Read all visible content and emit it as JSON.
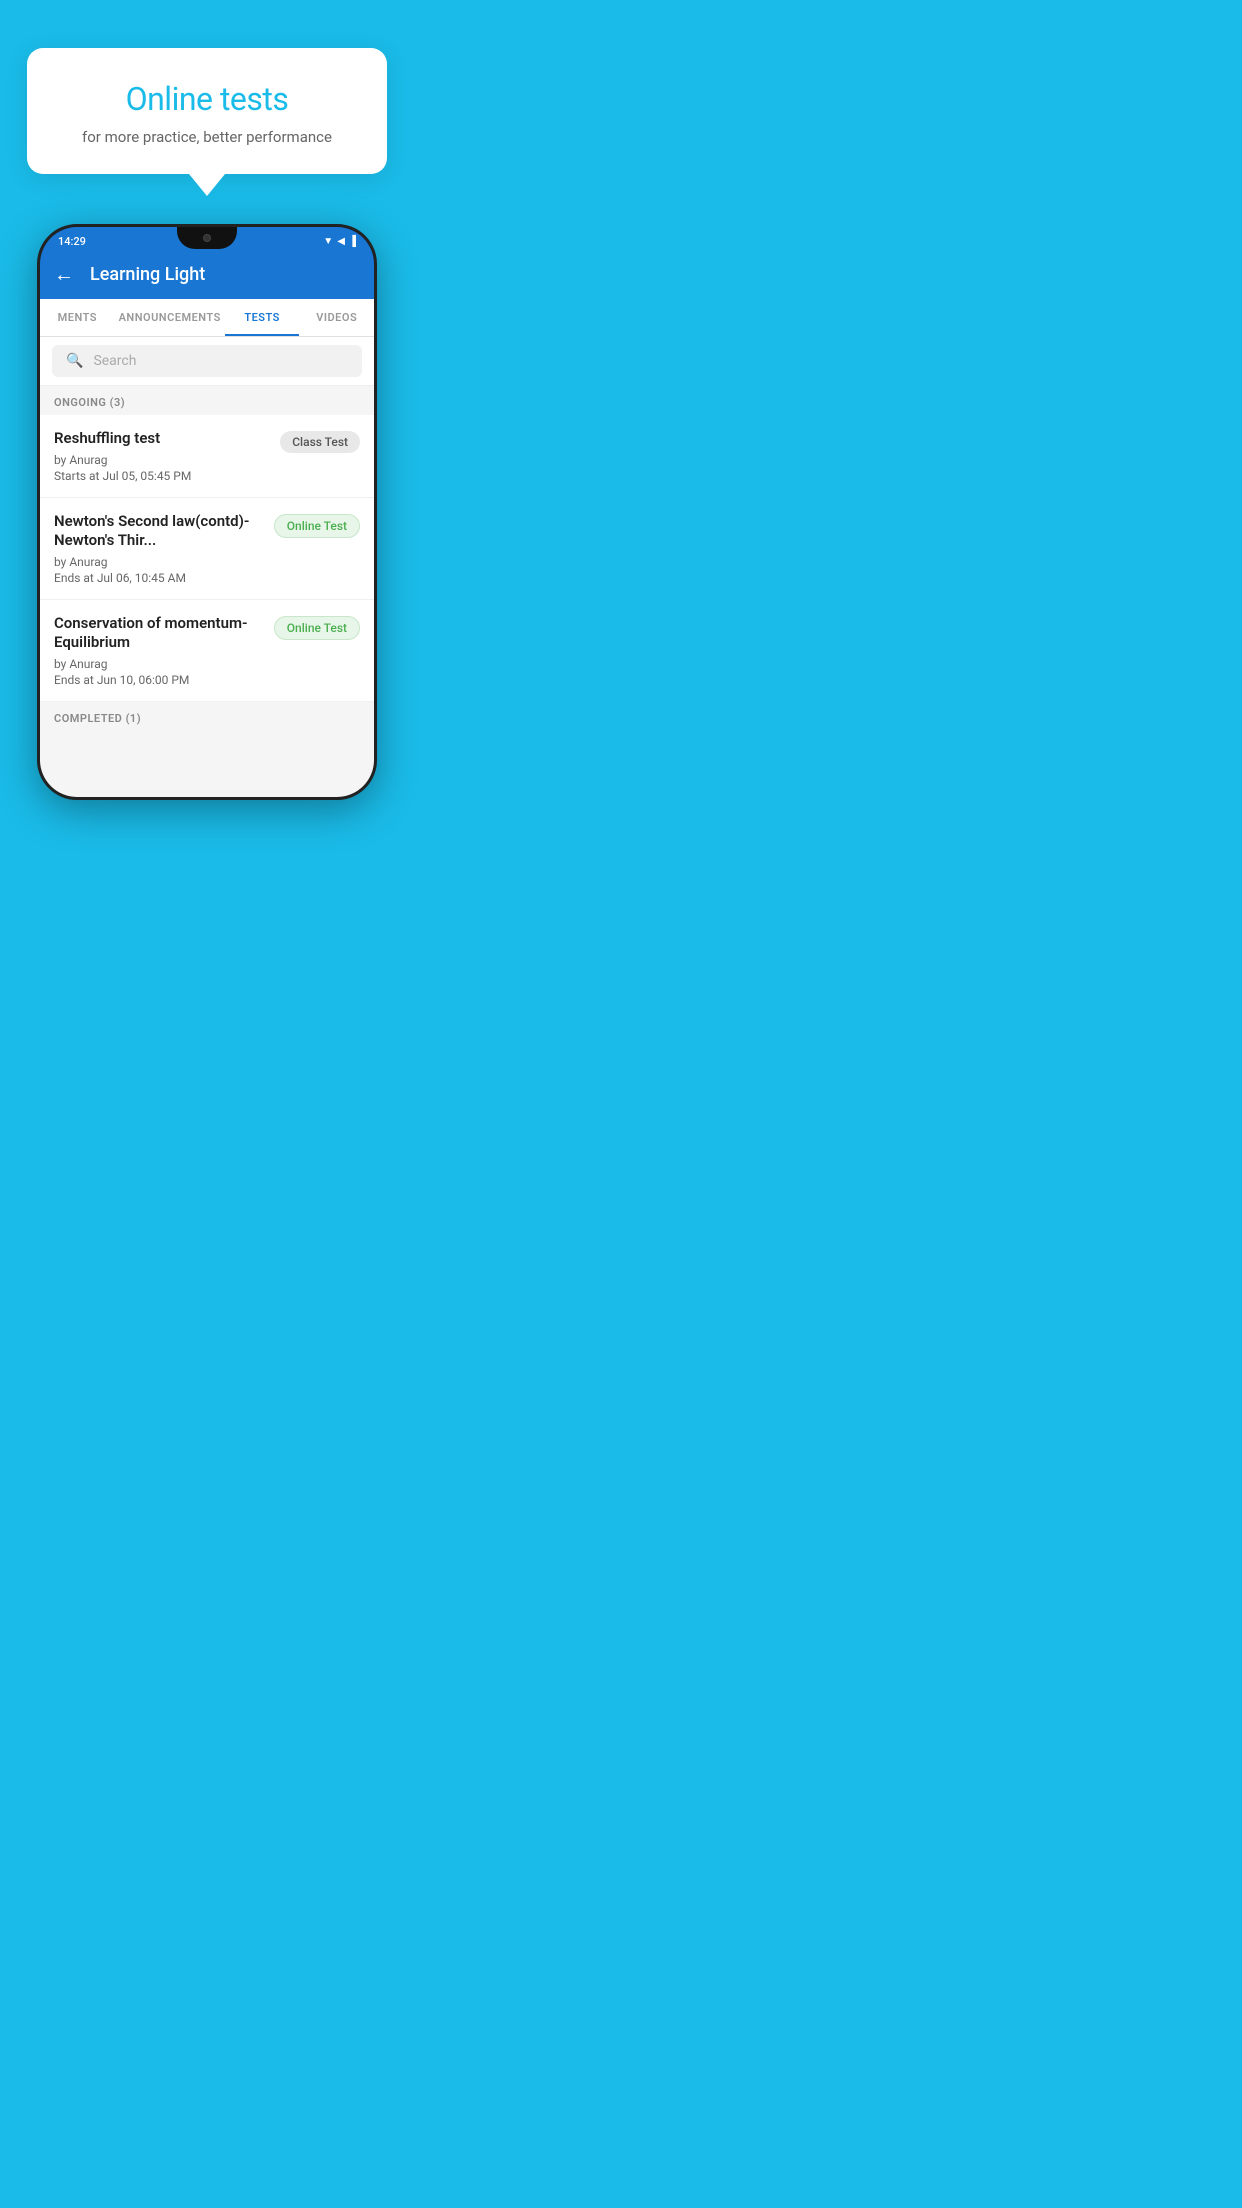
{
  "background": {
    "color": "#1ABBE8"
  },
  "hero": {
    "title": "Online tests",
    "subtitle": "for more practice, better performance"
  },
  "phone": {
    "statusBar": {
      "time": "14:29",
      "icons": [
        "wifi",
        "signal",
        "battery"
      ]
    },
    "appBar": {
      "title": "Learning Light",
      "backLabel": "←"
    },
    "tabs": [
      {
        "label": "MENTS",
        "active": false
      },
      {
        "label": "ANNOUNCEMENTS",
        "active": false
      },
      {
        "label": "TESTS",
        "active": true
      },
      {
        "label": "VIDEOS",
        "active": false
      }
    ],
    "search": {
      "placeholder": "Search"
    },
    "sections": [
      {
        "title": "ONGOING (3)",
        "tests": [
          {
            "name": "Reshuffling test",
            "author": "by Anurag",
            "time": "Starts at  Jul 05, 05:45 PM",
            "badge": "Class Test",
            "badgeType": "class"
          },
          {
            "name": "Newton's Second law(contd)-Newton's Thir...",
            "author": "by Anurag",
            "time": "Ends at  Jul 06, 10:45 AM",
            "badge": "Online Test",
            "badgeType": "online"
          },
          {
            "name": "Conservation of momentum-Equilibrium",
            "author": "by Anurag",
            "time": "Ends at  Jun 10, 06:00 PM",
            "badge": "Online Test",
            "badgeType": "online"
          }
        ]
      },
      {
        "title": "COMPLETED (1)",
        "tests": []
      }
    ]
  }
}
